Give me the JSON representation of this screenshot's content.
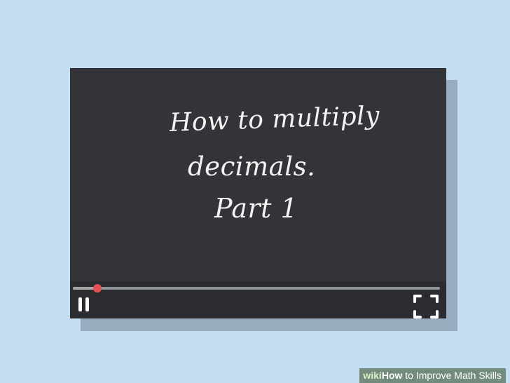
{
  "video": {
    "title_line_1": "How to multiply",
    "title_line_2": "decimals.",
    "title_line_3": "Part 1"
  },
  "player": {
    "progress": 0.067,
    "pause_icon": "pause-icon",
    "fullscreen_icon": "fullscreen-icon",
    "thumb_color": "#e35152"
  },
  "watermark": {
    "brand": "wiki",
    "how": "How",
    "rest": " to Improve Math Skills"
  }
}
